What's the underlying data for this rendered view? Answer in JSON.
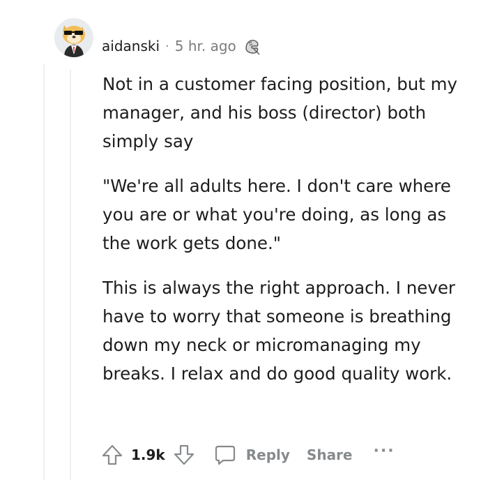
{
  "comment": {
    "username": "aidanski",
    "separator": "·",
    "time": "5 hr. ago",
    "award_icon": "award-icon",
    "avatar_icon": "avatar-icon",
    "paragraphs": [
      "Not in a customer facing position, but my manager, and his boss (director) both simply say",
      "\"We're all adults here. I don't care where you are or what you're doing, as long as the work gets done.\"",
      "This is always the right approach. I never have to worry that someone is breathing down my neck or micromanaging my breaks. I relax and do good quality work."
    ]
  },
  "actions": {
    "upvote_icon": "upvote-icon",
    "score": "1.9k",
    "downvote_icon": "downvote-icon",
    "reply_icon": "reply-icon",
    "reply_label": "Reply",
    "share_label": "Share",
    "more_label": "···"
  },
  "colors": {
    "text": "#1c1c1c",
    "muted": "#878a8c",
    "thread_line": "#edeff1"
  }
}
